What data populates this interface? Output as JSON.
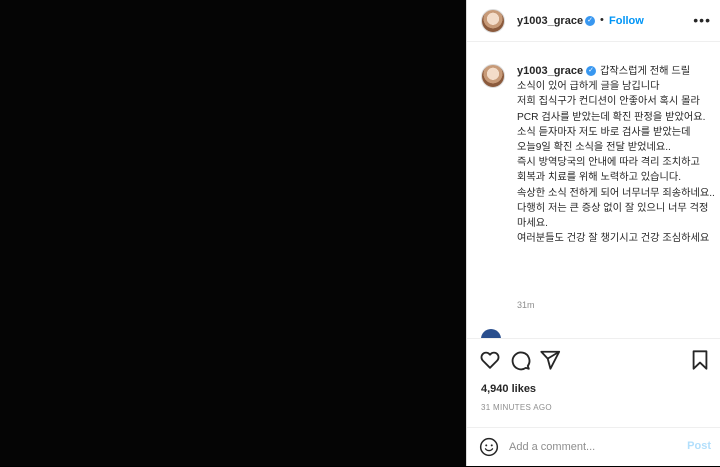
{
  "post": {
    "username": "y1003_grace",
    "follow_dot": "•",
    "follow_label": "Follow",
    "more_icon": "more-horizontal-icon",
    "verified_glyph": "✓"
  },
  "caption": {
    "username": "y1003_grace",
    "text": "갑작스럽게 전해 드릴 소식이 있어 급하게 글을 남깁니다\n저희 집식구가 컨디션이 안좋아서 혹시 몰라 PCR 검사를 받았는데 확진 판정을 받았어요.\n소식 듣자마자 저도 바로 검사를 받았는데 오늘9일 확진 소식을 전달 받었네요..\n즉시 방역당국의 안내에 따라 격리 조치하고 회복과 치료를 위해 노력하고 있습니다.\n속상한 소식 전하게 되어 너무너무 죄송하네요..\n다행히 저는 큰 증상 없이 잘 있으니 너무 걱정 마세요.\n여러분들도 건강 잘 챙기시고 건강 조심하세요",
    "time": "31m"
  },
  "comment_peek": {
    "text": "..."
  },
  "actions": {
    "like_icon": "heart-icon",
    "comment_icon": "comment-icon",
    "share_icon": "share-icon",
    "save_icon": "bookmark-icon",
    "likes": "4,940 likes",
    "time_ago": "31 MINUTES AGO"
  },
  "comment_box": {
    "placeholder": "Add a comment...",
    "post_label": "Post"
  },
  "colors": {
    "accent": "#0095f6",
    "verified": "#3897f0",
    "post_disabled": "#b2dffc",
    "media_bg": "#050505"
  }
}
